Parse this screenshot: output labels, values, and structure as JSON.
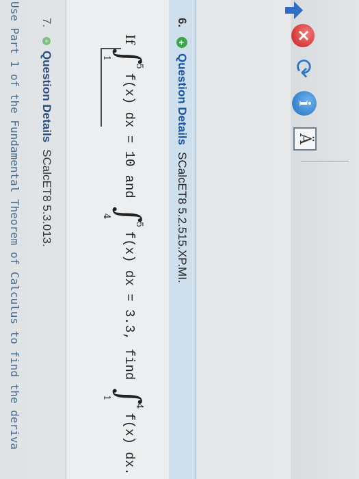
{
  "toolbar": {
    "icons": [
      "arrow-icon",
      "close-icon",
      "refresh-icon",
      "info-icon",
      "text-size-icon"
    ],
    "info_glyph": "i",
    "a_glyph": "Ä"
  },
  "question6": {
    "number": "6.",
    "details_label": "Question Details",
    "code": "SCalcET8 5.2.515.XP.MI.",
    "if_word": "If",
    "int1_upper": "5",
    "int1_lower": "1",
    "int1_expr": "f(x) dx = 10",
    "and_word": "and",
    "int2_upper": "5",
    "int2_lower": "4",
    "int2_expr": "f(x) dx = 3.3,",
    "find_word": "find",
    "int3_upper": "4",
    "int3_lower": "1",
    "int3_expr": "f(x) dx."
  },
  "question7": {
    "number": "7.",
    "details_label": "Question Details",
    "code": "SCalcET8 5.3.013.",
    "text": "Use Part 1 of the Fundamental Theorem of Calculus to find the deriva"
  }
}
